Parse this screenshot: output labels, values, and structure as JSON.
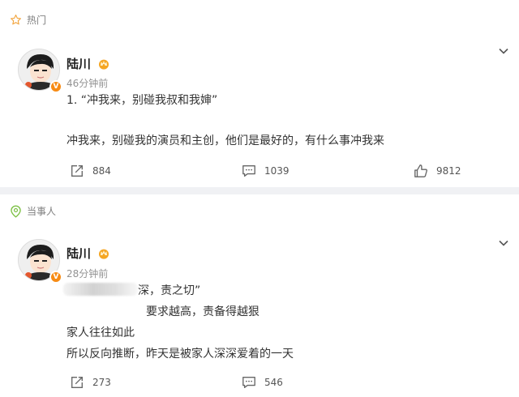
{
  "posts": [
    {
      "section_label": "热门",
      "section_icon": "star-outline-icon",
      "author": "陆川",
      "time": "46分钟前",
      "lines": [
        "1. “冲我来，别碰我叔和我婶”",
        "冲我来，别碰我的演员和主创，他们是最好的，有什么事冲我来"
      ],
      "repost_count": "884",
      "comment_count": "1039",
      "like_count": "9812"
    },
    {
      "section_label": "当事人",
      "section_icon": "location-pin-icon",
      "author": "陆川",
      "time": "28分钟前",
      "lines": [
        "深，责之切”",
        "要求越高，责备得越狠",
        "家人往往如此",
        "所以反向推断，昨天是被家人深深爱着的一天"
      ],
      "repost_count": "273",
      "comment_count": "546"
    }
  ],
  "colors": {
    "badge": "#f78b14",
    "crown": "#f5a623",
    "pin": "#7bc043",
    "star": "#f2a33a"
  }
}
